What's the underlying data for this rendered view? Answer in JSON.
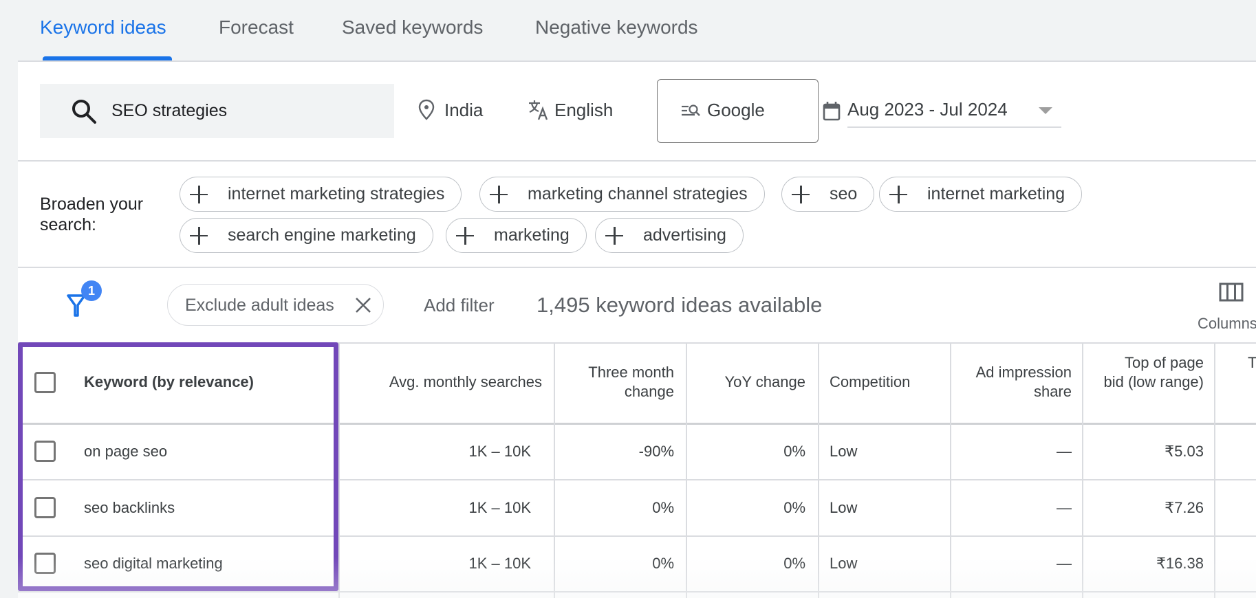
{
  "tabs": [
    {
      "label": "Keyword ideas",
      "active": true
    },
    {
      "label": "Forecast",
      "active": false
    },
    {
      "label": "Saved keywords",
      "active": false
    },
    {
      "label": "Negative keywords",
      "active": false
    }
  ],
  "search": {
    "value": "SEO strategies",
    "icon": "search-icon"
  },
  "targeting": {
    "location": {
      "label": "India",
      "icon": "location-pin-icon"
    },
    "language": {
      "label": "English",
      "icon": "translate-icon"
    },
    "network": {
      "label": "Google",
      "icon": "search-network-icon"
    },
    "date_range": {
      "label": "Aug 2023 - Jul 2024",
      "icon": "calendar-icon"
    }
  },
  "broaden": {
    "label": "Broaden your search:",
    "chips": [
      "internet marketing strategies",
      "marketing channel strategies",
      "seo",
      "internet marketing",
      "search engine marketing",
      "marketing",
      "advertising"
    ]
  },
  "filters": {
    "active_count": "1",
    "applied": "Exclude adult ideas",
    "add_filter_label": "Add filter",
    "idea_count_text": "1,495 keyword ideas available",
    "columns_label": "Columns",
    "colors": {
      "accent": "#1a73e8",
      "badge": "#4285f4",
      "highlight": "#7248b9"
    }
  },
  "table": {
    "headers": {
      "keyword": "Keyword (by relevance)",
      "avg_monthly": "Avg. monthly searches",
      "three_month": "Three month change",
      "yoy": "YoY change",
      "competition": "Competition",
      "ad_impression": "Ad impression share",
      "top_bid_low": "Top of page bid (low range)",
      "next_partial": "T"
    },
    "rows": [
      {
        "keyword": "on page seo",
        "avg_monthly": "1K – 10K",
        "three_month": "-90%",
        "yoy": "0%",
        "competition": "Low",
        "ad_impression": "—",
        "top_bid_low": "₹5.03"
      },
      {
        "keyword": "seo backlinks",
        "avg_monthly": "1K – 10K",
        "three_month": "0%",
        "yoy": "0%",
        "competition": "Low",
        "ad_impression": "—",
        "top_bid_low": "₹7.26"
      },
      {
        "keyword": "seo digital marketing",
        "avg_monthly": "1K – 10K",
        "three_month": "0%",
        "yoy": "0%",
        "competition": "Low",
        "ad_impression": "—",
        "top_bid_low": "₹16.38"
      }
    ]
  }
}
